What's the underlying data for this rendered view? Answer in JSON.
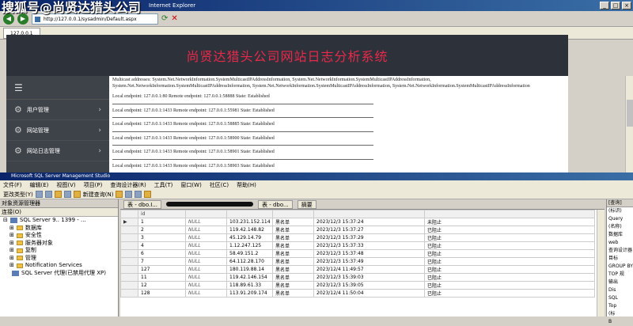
{
  "ie": {
    "watermark": "搜狐号@尚贤达猎头公司",
    "title": "Internet Explorer",
    "address": "http://127.0.0.1/sysadmin/Default.aspx",
    "tab_label": "127.0.0.1",
    "banner": "尚贤达猎头公司网站日志分析系统",
    "sidebar": [
      {
        "label": "用户管理"
      },
      {
        "label": "网站管理"
      },
      {
        "label": "网站日志管理"
      }
    ],
    "multicast": "Multicast addresses: System.Net.NetworkInformation.SystemMulticastIPAddressInformation, System.Net.NetworkInformation.SystemMulticastIPAddressInformation, System.Net.NetworkInformation.SystemMulticastIPAddressInformation, System.Net.NetworkInformation.SystemMulticastIPAddressInformation, System.Net.NetworkInformation.SystemMulticastIPAddressInformation",
    "endpoints": [
      "Local endpoint: 127.0.0.1:80 Remote endpoint: 127.0.0.1:58888 State: Established",
      "Local endpoint: 127.0.0.1:1433 Remote endpoint: 127.0.0.1:55981 State: Established",
      "Local endpoint: 127.0.0.1:1433 Remote endpoint: 127.0.0.1:58885 State: Established",
      "Local endpoint: 127.0.0.1:1433 Remote endpoint: 127.0.0.1:58900 State: Established",
      "Local endpoint: 127.0.0.1:1433 Remote endpoint: 127.0.0.1:58901 State: Established",
      "Local endpoint: 127.0.0.1:1433 Remote endpoint: 127.0.0.1:58903 State: Established"
    ]
  },
  "ssms": {
    "title": "Microsoft SQL Server Management Studio",
    "menu": [
      "文件(F)",
      "编辑(E)",
      "视图(V)",
      "项目(P)",
      "查询设计器(R)",
      "工具(T)",
      "窗口(W)",
      "社区(C)",
      "帮助(H)"
    ],
    "change_type": "更改类型(Y)",
    "new_query": "新建查询(N)",
    "oe_title": "对象资源管理器",
    "oe_connect": "连接(O)",
    "tree_root": "SQL Server 9.. 1399 - ...",
    "tree_items": [
      "数据库",
      "安全性",
      "服务器对象",
      "复制",
      "管理",
      "Notification Services",
      "SQL Server 代理(已禁用代理 XP)"
    ],
    "grid_tabs": [
      "表 - dbo.I...",
      "表 - dbo...",
      "摘要"
    ],
    "col_header": "id",
    "rows": [
      {
        "rn": "",
        "id": "1",
        "c1": "NULL",
        "ip": "103.231.152.114",
        "type": "黑名单",
        "time": "2023/12/3 15:37:24",
        "status": "未阻止"
      },
      {
        "rn": "",
        "id": "2",
        "c1": "NULL",
        "ip": "119.42.148.82",
        "type": "黑名单",
        "time": "2023/12/3 15:37:27",
        "status": "已阻止"
      },
      {
        "rn": "",
        "id": "3",
        "c1": "NULL",
        "ip": "45.129.14.79",
        "type": "黑名单",
        "time": "2023/12/3 15:37:29",
        "status": "已阻止"
      },
      {
        "rn": "",
        "id": "4",
        "c1": "NULL",
        "ip": "1.12.247.125",
        "type": "黑名单",
        "time": "2023/12/3 15:37:33",
        "status": "已阻止"
      },
      {
        "rn": "",
        "id": "6",
        "c1": "NULL",
        "ip": "58.49.151.2",
        "type": "黑名单",
        "time": "2023/12/3 15:37:48",
        "status": "已阻止"
      },
      {
        "rn": "",
        "id": "7",
        "c1": "NULL",
        "ip": "64.112.28.170",
        "type": "黑名单",
        "time": "2023/12/3 15:37:49",
        "status": "已阻止"
      },
      {
        "rn": "",
        "id": "127",
        "c1": "NULL",
        "ip": "180.119.88.14",
        "type": "黑名单",
        "time": "2023/12/4 11:49:57",
        "status": "已阻止"
      },
      {
        "rn": "",
        "id": "11",
        "c1": "NULL",
        "ip": "119.42.146.154",
        "type": "黑名单",
        "time": "2023/12/3 15:39:03",
        "status": "已阻止"
      },
      {
        "rn": "",
        "id": "12",
        "c1": "NULL",
        "ip": "118.89.61.33",
        "type": "黑名单",
        "time": "2023/12/3 15:39:05",
        "status": "已阻止"
      },
      {
        "rn": "",
        "id": "128",
        "c1": "NULL",
        "ip": "113.91.209.174",
        "type": "黑名单",
        "time": "2023/12/4 11:50:04",
        "status": "已阻止"
      }
    ],
    "props": [
      "[查询]",
      "(标识)",
      "Query",
      "(名称)",
      "数据库",
      "web",
      "查询设计器",
      "目标",
      "GROUP BY",
      "TOP 规",
      "输出",
      "Dis",
      "SQL",
      "Top",
      "(标",
      "B"
    ]
  }
}
